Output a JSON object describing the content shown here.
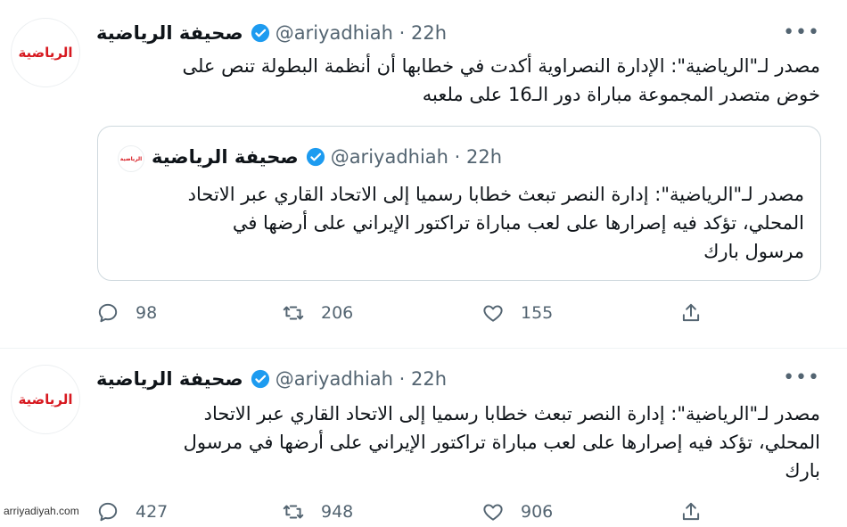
{
  "tweet1": {
    "name": "صحيفة الرياضية",
    "handle": "@ariyadhiah · 22h",
    "text_line1": "مصدر لـ\"الرياضية\": الإدارة النصراوية أكدت في خطابها أن أنظمة البطولة تنص على",
    "text_line2": "خوض متصدر المجموعة مباراة دور الـ16 على ملعبه",
    "quote": {
      "name": "صحيفة الرياضية",
      "handle": "@ariyadhiah · 22h",
      "text_line1": "مصدر لـ\"الرياضية\": إدارة النصر تبعث خطابا رسميا إلى الاتحاد القاري عبر الاتحاد",
      "text_line2": "المحلي، تؤكد فيه إصرارها على لعب مباراة تراكتور الإيراني على أرضها في",
      "text_line3": "مرسول بارك"
    },
    "replies": "98",
    "retweets": "206",
    "likes": "155"
  },
  "tweet2": {
    "name": "صحيفة الرياضية",
    "handle": "@ariyadhiah · 22h",
    "text_line1": "مصدر لـ\"الرياضية\": إدارة النصر تبعث خطابا رسميا إلى الاتحاد القاري عبر الاتحاد",
    "text_line2": "المحلي، تؤكد فيه إصرارها على لعب مباراة تراكتور الإيراني على أرضها في مرسول",
    "text_line3": "بارك",
    "replies": "427",
    "retweets": "948",
    "likes": "906"
  },
  "avatar_logo_text": "الرياضية",
  "more_label": "•••",
  "watermark": "arriyadiyah.com",
  "colors": {
    "verified": "#1d9bf0",
    "logo": "#d71920",
    "secondary": "#536471"
  }
}
